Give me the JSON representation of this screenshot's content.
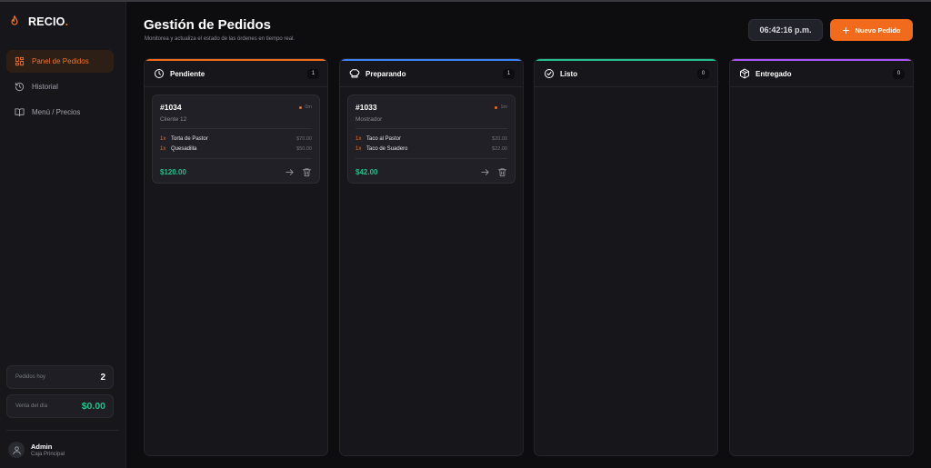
{
  "app": {
    "brand_name": "RECIO",
    "brand_dot": ".",
    "accent_color": "#f26b1d"
  },
  "sidebar": {
    "items": [
      {
        "label": "Panel de Pedidos",
        "icon": "grid-icon",
        "active": true
      },
      {
        "label": "Historial",
        "icon": "history-icon",
        "active": false
      },
      {
        "label": "Menú / Precios",
        "icon": "book-icon",
        "active": false
      }
    ],
    "stats": [
      {
        "label": "Pedidos hoy",
        "value": "2"
      },
      {
        "label": "Venta del día",
        "value": "$0.00"
      }
    ],
    "user": {
      "name": "Admin",
      "role": "Caja Principal"
    }
  },
  "header": {
    "title": "Gestión de Pedidos",
    "subtitle": "Monitorea y actualiza el estado de las órdenes en tiempo real.",
    "clock": "06:42:16 p.m.",
    "new_order_label": "Nuevo Pedido"
  },
  "columns": [
    {
      "title": "Pendiente",
      "count": "1",
      "accent": "#f26b1d",
      "icon": "clock-icon",
      "orders": [
        {
          "id": "#1034",
          "elapsed": "0m",
          "client": "Cliente 12",
          "items": [
            {
              "qty": "1x",
              "name": "Torta de Pastor",
              "price": "$70.00"
            },
            {
              "qty": "1x",
              "name": "Quesadilla",
              "price": "$50.00"
            }
          ],
          "total": "$120.00"
        }
      ]
    },
    {
      "title": "Preparando",
      "count": "1",
      "accent": "#3b82f6",
      "icon": "chef-hat-icon",
      "orders": [
        {
          "id": "#1033",
          "elapsed": "1m",
          "client": "Mostrador",
          "items": [
            {
              "qty": "1x",
              "name": "Taco al Pastor",
              "price": "$20.00"
            },
            {
              "qty": "1x",
              "name": "Taco de Suadero",
              "price": "$22.00"
            }
          ],
          "total": "$42.00"
        }
      ]
    },
    {
      "title": "Listo",
      "count": "0",
      "accent": "#22c08a",
      "icon": "check-circle-icon",
      "orders": []
    },
    {
      "title": "Entregado",
      "count": "0",
      "accent": "#a855f7",
      "icon": "package-icon",
      "orders": []
    }
  ]
}
